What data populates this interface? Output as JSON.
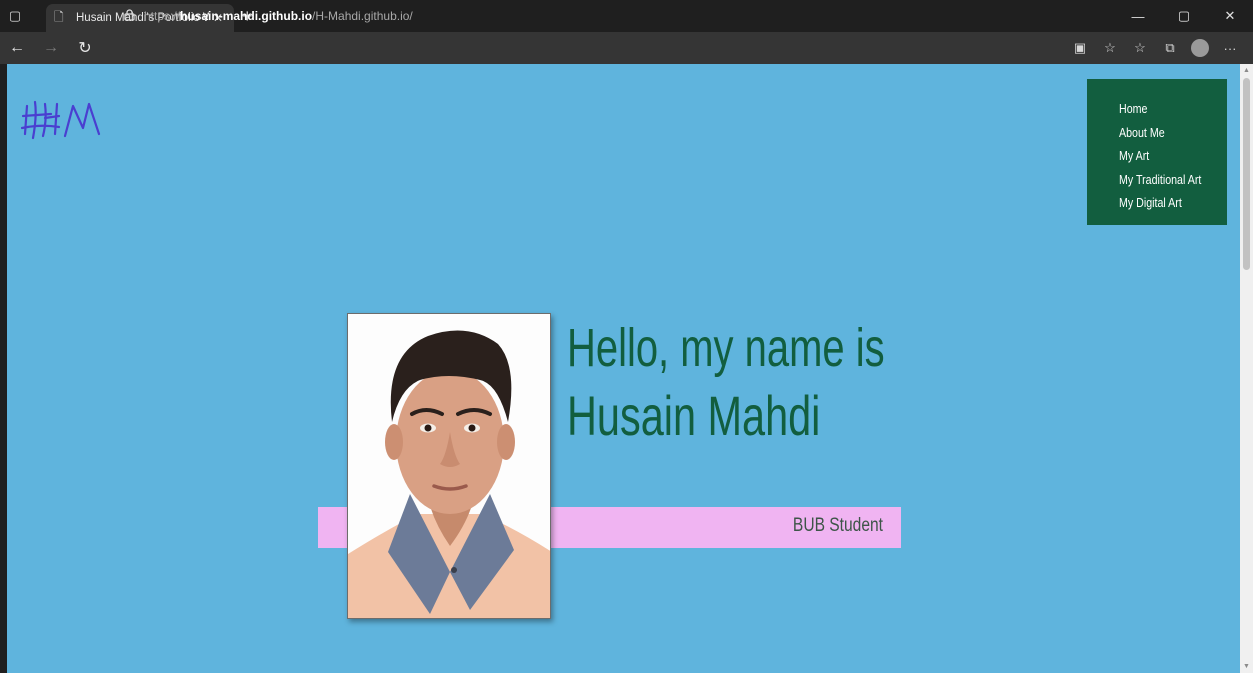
{
  "browser": {
    "tab_title": "Husain Mahdi's Portfolio Websit",
    "url_protocol": "https://",
    "url_host": "husain-mahdi.github.io",
    "url_path": "/H-Mahdi.github.io/"
  },
  "icons": {
    "sidebar": "▢",
    "page": "🗋",
    "close": "✕",
    "plus": "+",
    "minimize": "—",
    "restore": "▢",
    "back": "←",
    "forward": "→",
    "refresh": "↻",
    "lock": "🔒",
    "reader": "▣",
    "favorite_add": "☆",
    "favorites": "☆",
    "collections": "⧉",
    "more": "···"
  },
  "logo_text": "HM",
  "nav": {
    "items": [
      "Home",
      "About Me",
      "My Art",
      "My Traditional Art",
      "My Digital Art"
    ]
  },
  "hero": {
    "greeting": "Hello, my name is",
    "name": "Husain Mahdi",
    "role": "BUB Student"
  },
  "colors": {
    "page_bg": "#5fb4dd",
    "nav_bg": "#125e3f",
    "heading": "#125e3f",
    "stripe": "#f0b4f2",
    "logo": "#4a3fd0"
  }
}
